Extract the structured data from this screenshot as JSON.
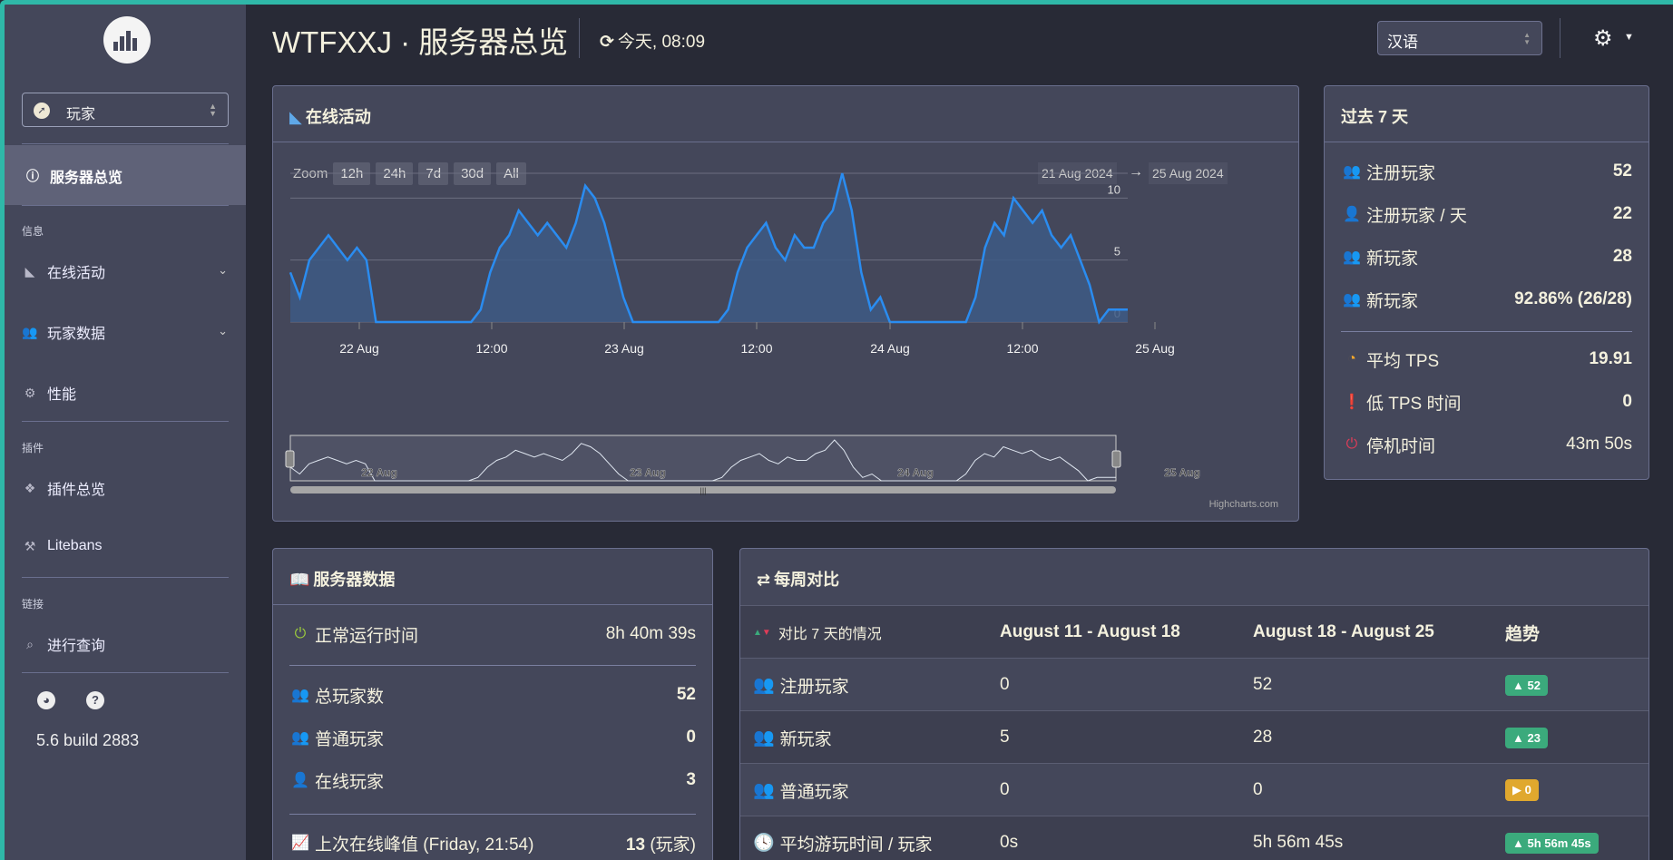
{
  "app": {
    "title": "WTFXXJ · 服务器总览",
    "refresh": "今天, 08:09",
    "version": "5.6 build 2883"
  },
  "colors": {
    "blue": "#4e9ce8",
    "green": "#9ccc3c",
    "orange": "#f4a72b",
    "red": "#e03c58",
    "teal_frame": "#2fb8a8"
  },
  "sidebar": {
    "selector": "玩家",
    "active": "服务器总览",
    "section_info": "信息",
    "online_activity": "在线活动",
    "player_data": "玩家数据",
    "performance": "性能",
    "section_plugins": "插件",
    "plugins_overview": "插件总览",
    "litebans": "Litebans",
    "section_links": "链接",
    "query": "进行查询"
  },
  "header": {
    "language": "汉语"
  },
  "online_activity": {
    "title": "在线活动",
    "zoom_label": "Zoom",
    "zoom_buttons": [
      "12h",
      "24h",
      "7d",
      "30d",
      "All"
    ],
    "range_from": "21 Aug 2024",
    "range_arrow": "→",
    "range_to": "25 Aug 2024",
    "credit": "Highcharts.com"
  },
  "chart_data": {
    "type": "area",
    "title": "",
    "xlabel": "",
    "ylabel": "",
    "ylim": [
      0,
      12
    ],
    "yticks": [
      0,
      5,
      10
    ],
    "x_tick_labels": [
      "22 Aug",
      "12:00",
      "23 Aug",
      "12:00",
      "24 Aug",
      "12:00",
      "25 Aug"
    ],
    "navigator_labels": [
      "22 Aug",
      "23 Aug",
      "24 Aug",
      "25 Aug"
    ],
    "x_hours": [
      0,
      1,
      2,
      3,
      4,
      5,
      6,
      7,
      8,
      9,
      10,
      11,
      12,
      13,
      14,
      15,
      16,
      17,
      18,
      19,
      20,
      21,
      22,
      23,
      24,
      25,
      26,
      27,
      28,
      29,
      30,
      31,
      32,
      33,
      34,
      35,
      36,
      37,
      38,
      39,
      40,
      41,
      42,
      43,
      44,
      45,
      46,
      47,
      48,
      49,
      50,
      51,
      52,
      53,
      54,
      55,
      56,
      57,
      58,
      59,
      60,
      61,
      62,
      63,
      64,
      65,
      66,
      67,
      68,
      69,
      70,
      71,
      72,
      73,
      74,
      75,
      76,
      77,
      78,
      79,
      80,
      81,
      82,
      83,
      84,
      85,
      86,
      87,
      88
    ],
    "series": [
      {
        "values": [
          4,
          2,
          5,
          6,
          7,
          6,
          5,
          6,
          5,
          0,
          0,
          0,
          0,
          0,
          0,
          0,
          0,
          0,
          0,
          0,
          1,
          4,
          6,
          7,
          9,
          8,
          7,
          8,
          7,
          6,
          8,
          11,
          10,
          8,
          5,
          2,
          0,
          0,
          0,
          0,
          0,
          0,
          0,
          0,
          0,
          0,
          1,
          4,
          6,
          7,
          8,
          6,
          5,
          7,
          6,
          6,
          8,
          9,
          12,
          9,
          4,
          1,
          2,
          0,
          0,
          0,
          0,
          0,
          0,
          0,
          0,
          0,
          2,
          6,
          8,
          7,
          10,
          9,
          8,
          9,
          7,
          6,
          7,
          5,
          3,
          0,
          1,
          1,
          1,
          1,
          2,
          4
        ]
      }
    ]
  },
  "last7": {
    "title": "过去 7 天",
    "rows": [
      {
        "label": "注册玩家",
        "value": "52"
      },
      {
        "label": "注册玩家 / 天",
        "value": "22"
      },
      {
        "label": "新玩家",
        "value": "28"
      },
      {
        "label": "新玩家",
        "value": "92.86% (26/28)"
      }
    ],
    "rows2": [
      {
        "label": "平均 TPS",
        "value": "19.91"
      },
      {
        "label": "低 TPS 时间",
        "value": "0"
      },
      {
        "label": "停机时间",
        "value": "43m 50s"
      }
    ]
  },
  "server_data": {
    "title": "服务器数据",
    "uptime_label": "正常运行时间",
    "uptime": "8h 40m 39s",
    "total_label": "总玩家数",
    "total": "52",
    "regular_label": "普通玩家",
    "regular": "0",
    "online_label": "在线玩家",
    "online": "3",
    "peak_label": "上次在线峰值 (Friday, 21:54)",
    "peak": "13",
    "peak_unit": "(玩家)"
  },
  "weekly": {
    "title": "每周对比",
    "headers": [
      "对比 7 天的情况",
      "August 11 - August 18",
      "August 18 - August 25",
      "趋势"
    ],
    "rows": [
      {
        "label": "注册玩家",
        "a": "0",
        "b": "52",
        "trend": "52",
        "dir": "up"
      },
      {
        "label": "新玩家",
        "a": "5",
        "b": "28",
        "trend": "23",
        "dir": "up"
      },
      {
        "label": "普通玩家",
        "a": "0",
        "b": "0",
        "trend": "0",
        "dir": "flat"
      },
      {
        "label": "平均游玩时间 / 玩家",
        "a": "0s",
        "b": "5h 56m 45s",
        "trend": "5h 56m 45s",
        "dir": "up"
      }
    ]
  }
}
